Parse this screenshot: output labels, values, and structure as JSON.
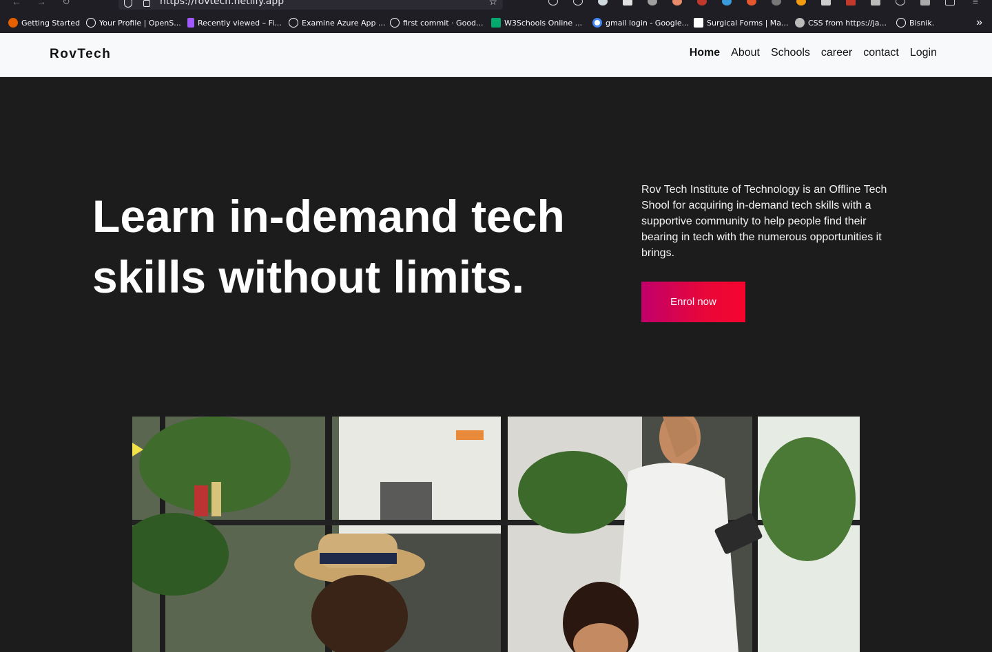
{
  "browser": {
    "url": "https://rovtech.netlify.app",
    "bookmarks": [
      {
        "label": "Getting Started",
        "icon": "firefox-icon"
      },
      {
        "label": "Your Profile | OpenS...",
        "icon": "globe-icon"
      },
      {
        "label": "Recently viewed – Fi...",
        "icon": "figma-icon"
      },
      {
        "label": "Examine Azure App ...",
        "icon": "globe-icon"
      },
      {
        "label": "first commit · Good...",
        "icon": "github-icon"
      },
      {
        "label": "W3Schools Online ...",
        "icon": "w3schools-icon"
      },
      {
        "label": "gmail login - Google...",
        "icon": "google-icon"
      },
      {
        "label": "Surgical Forms | Ma...",
        "icon": "form-icon"
      },
      {
        "label": "CSS from https://ja...",
        "icon": "gear-icon"
      },
      {
        "label": "Bisnik.",
        "icon": "globe-icon"
      }
    ]
  },
  "navbar": {
    "brand": "RovTech",
    "links": [
      {
        "label": "Home",
        "active": true
      },
      {
        "label": "About"
      },
      {
        "label": "Schools"
      },
      {
        "label": "career"
      },
      {
        "label": "contact"
      },
      {
        "label": "Login"
      }
    ]
  },
  "hero": {
    "headline": "Learn in-demand tech skills without limits.",
    "description": "Rov Tech Institute of Technology is an Offline Tech Shool for acquiring in-demand tech skills with a supportive community to help people find their bearing in tech with the numerous opportunities it brings.",
    "cta_label": "Enrol now",
    "cta_gradient": [
      "#c1006a",
      "#f5052d"
    ]
  },
  "colors": {
    "navbar_bg": "#f8f9fa",
    "hero_bg": "#1c1c1c",
    "chrome_bg": "#1f1e24"
  }
}
